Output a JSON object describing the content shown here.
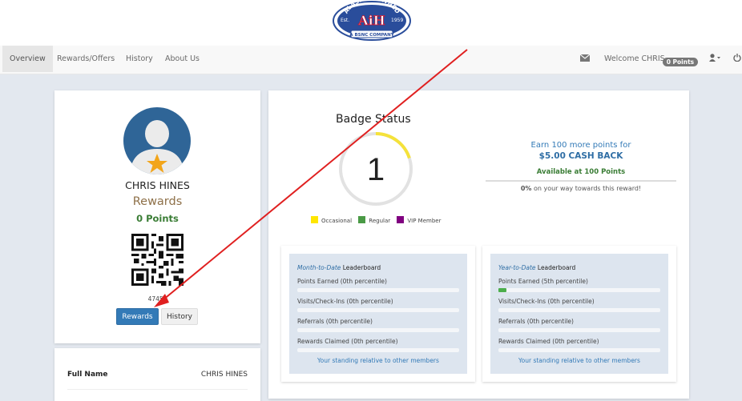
{
  "logo": {
    "arc_text": "ALASKAN OWNED",
    "letters": "AiH",
    "left_text": "Est.",
    "right_text": "1959",
    "ribbon_text": "A BSNC COMPANY"
  },
  "nav": {
    "items": [
      {
        "label": "Overview"
      },
      {
        "label": "Rewards/Offers"
      },
      {
        "label": "History"
      },
      {
        "label": "About Us"
      }
    ],
    "welcome": "Welcome CHRIS",
    "points_badge": "0 Points"
  },
  "profile": {
    "name": "CHRIS HINES",
    "rewards_label": "Rewards",
    "points": "0 Points",
    "member_id": "47455",
    "rewards_button": "Rewards",
    "history_button": "History"
  },
  "info": {
    "full_name_label": "Full Name",
    "full_name_value": "CHRIS HINES"
  },
  "badge": {
    "title": "Badge Status",
    "level": "1",
    "legend": [
      {
        "label": "Occasional",
        "color": "#ffe600"
      },
      {
        "label": "Regular",
        "color": "#4a9a46"
      },
      {
        "label": "VIP Member",
        "color": "#800080"
      }
    ],
    "ring_fraction": 0.2
  },
  "reward": {
    "earn_text": "Earn 100 more points for",
    "cash_text": "$5.00 CASH BACK",
    "available_text": "Available at 100 Points",
    "progress_pct": "0%",
    "progress_text": " on your way towards this reward!"
  },
  "leaderboards": [
    {
      "title_italic": "Month-to-Date",
      "title_rest": " Leaderboard",
      "rows": [
        {
          "label": "Points Earned (0th percentile)",
          "fill": 0
        },
        {
          "label": "Visits/Check-Ins (0th percentile)",
          "fill": 0
        },
        {
          "label": "Referrals (0th percentile)",
          "fill": 0
        },
        {
          "label": "Rewards Claimed (0th percentile)",
          "fill": 0
        }
      ],
      "footer": "Your standing relative to other members"
    },
    {
      "title_italic": "Year-to-Date",
      "title_rest": " Leaderboard",
      "rows": [
        {
          "label": "Points Earned (5th percentile)",
          "fill": 0.05
        },
        {
          "label": "Visits/Check-Ins (0th percentile)",
          "fill": 0
        },
        {
          "label": "Referrals (0th percentile)",
          "fill": 0
        },
        {
          "label": "Rewards Claimed (0th percentile)",
          "fill": 0
        }
      ],
      "footer": "Your standing relative to other members"
    }
  ],
  "colors": {
    "primary": "#337ab7",
    "success": "#3a7d35",
    "annotation": "#e02020"
  }
}
